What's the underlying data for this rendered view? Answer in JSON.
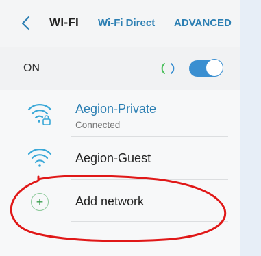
{
  "header": {
    "title": "WI-FI",
    "tabs": [
      "Wi-Fi Direct",
      "ADVANCED"
    ]
  },
  "wifi_switch": {
    "label": "ON",
    "state": "on"
  },
  "networks": [
    {
      "name": "Aegion-Private",
      "status": "Connected",
      "secured": true,
      "active": true
    },
    {
      "name": "Aegion-Guest",
      "status": "",
      "secured": false,
      "active": false
    }
  ],
  "add_network": {
    "label": "Add network"
  },
  "colors": {
    "accent": "#2c7fb3",
    "toggle": "#3a8fd1",
    "wifi_icon": "#3aa8d8",
    "add_icon": "#3a9d4f",
    "annotation": "#e01818"
  },
  "icons": [
    "back-arrow-icon",
    "loading-spinner-icon",
    "wifi-lock-icon",
    "wifi-icon",
    "plus-icon"
  ]
}
